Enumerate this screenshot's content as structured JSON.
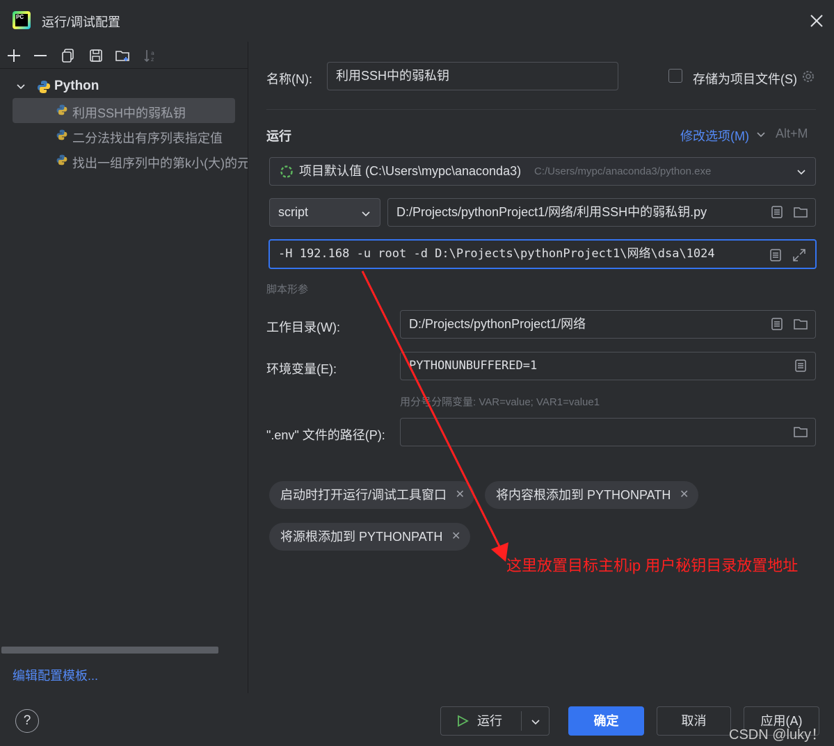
{
  "window": {
    "title": "运行/调试配置"
  },
  "sidebar": {
    "group": "Python",
    "items": [
      {
        "label": "利用SSH中的弱私钥",
        "selected": true
      },
      {
        "label": "二分法找出有序列表指定值",
        "selected": false
      },
      {
        "label": "找出一组序列中的第k小(大)的元",
        "selected": false
      }
    ],
    "edit_templates": "编辑配置模板..."
  },
  "form": {
    "name_label": "名称(N):",
    "name_value": "利用SSH中的弱私钥",
    "store_as_project_file": "存储为项目文件(S)",
    "run_section": "运行",
    "modify_options": "修改选项(M)",
    "modify_shortcut": "Alt+M",
    "interpreter_name": "项目默认值 (C:\\Users\\mypc\\anaconda3)",
    "interpreter_path": "C:/Users/mypc/anaconda3/python.exe",
    "script_type": "script",
    "script_path": "D:/Projects/pythonProject1/网络/利用SSH中的弱私钥.py",
    "script_params": "-H 192.168 -u root -d D:\\Projects\\pythonProject1\\网络\\dsa\\1024",
    "script_params_hint": "脚本形参",
    "workdir_label": "工作目录(W):",
    "workdir_value": "D:/Projects/pythonProject1/网络",
    "env_label": "环境变量(E):",
    "env_value": "PYTHONUNBUFFERED=1",
    "env_hint": "用分号分隔变量: VAR=value; VAR1=value1",
    "envfile_label": "\".env\" 文件的路径(P):",
    "envfile_value": ""
  },
  "chips": [
    "启动时打开运行/调试工具窗口",
    "将内容根添加到 PYTHONPATH",
    "将源根添加到 PYTHONPATH"
  ],
  "footer": {
    "run": "运行",
    "ok": "确定",
    "cancel": "取消",
    "apply": "应用(A)",
    "help": "?"
  },
  "annotation": "这里放置目标主机ip 用户秘钥目录放置地址",
  "watermark": "CSDN @luky！",
  "colors": {
    "accent": "#3574f0",
    "annotation": "#ff2020",
    "link": "#548af7"
  }
}
